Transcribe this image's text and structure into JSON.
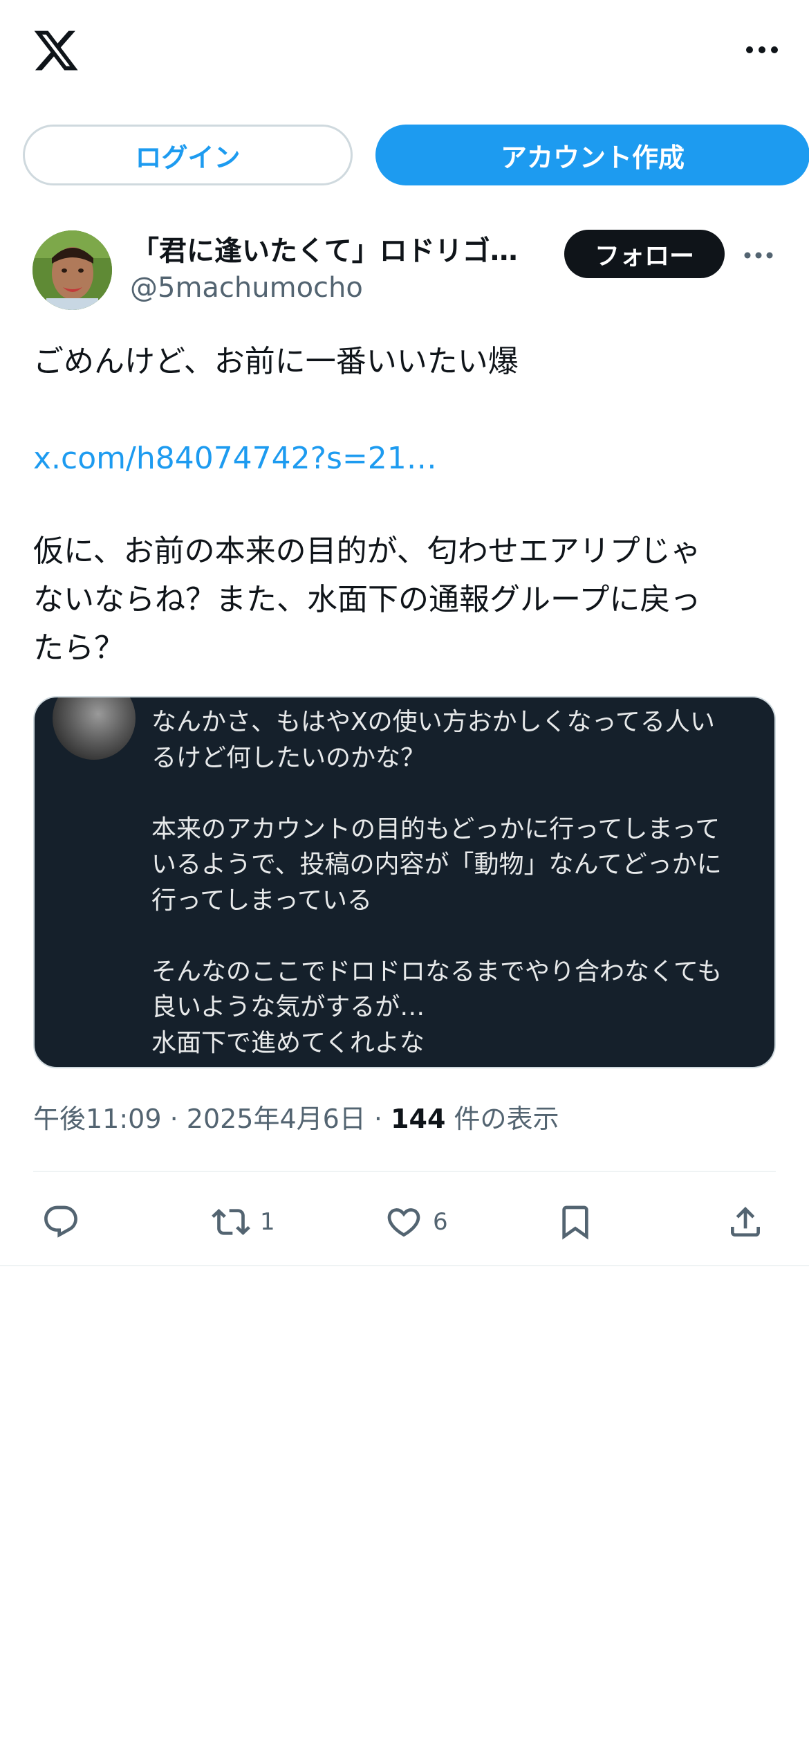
{
  "header": {
    "logo_icon": "x-logo-icon",
    "more_icon": "more-horizontal-icon"
  },
  "auth": {
    "login_label": "ログイン",
    "signup_label": "アカウント作成"
  },
  "tweet": {
    "display_name": "「君に逢いたくて」ロドリゴ…",
    "handle": "@5machumocho",
    "follow_label": "フォロー",
    "text_line1": "ごめんけど、お前に一番いいたい爆",
    "link": "x.com/h84074742?s=21…",
    "text_para2": [
      "仮に、お前の本来の目的が、匂わせエアリプじゃ",
      "ないならね？また、水面下の通報グループに戻っ",
      "たら？"
    ],
    "quote": {
      "lines": [
        "なんかさ、もはやXの使い方おかしくなってる人い",
        "るけど何したいのかな？",
        "",
        "本来のアカウントの目的もどっかに行ってしまって",
        "いるようで、投稿の内容が「動物」なんてどっかに",
        "行ってしまっている",
        "",
        "そんなのここでドロドロなるまでやり合わなくても",
        "良いような気がするが…",
        "水面下で進めてくれよな"
      ]
    },
    "meta": {
      "time": "午後11:09",
      "separator": " · ",
      "date": "2025年4月6日",
      "views_count": "144",
      "views_label": " 件の表示"
    },
    "actions": {
      "reply_count": "",
      "retweet_count": "1",
      "like_count": "6"
    }
  },
  "colors": {
    "accent": "#1d9bf0",
    "text_primary": "#0f1419",
    "text_secondary": "#536471",
    "quote_bg": "#15202b"
  }
}
